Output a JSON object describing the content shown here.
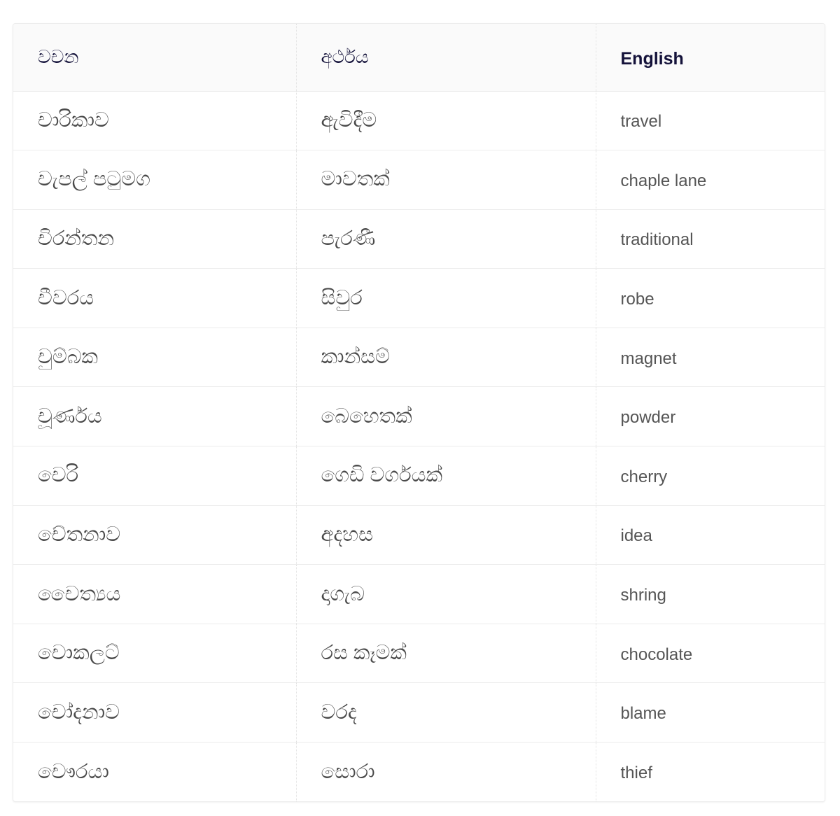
{
  "table": {
    "headers": [
      "වචන",
      "අර්ථය",
      "English"
    ],
    "rows": [
      [
        "චාරිකාව",
        "ඇවිදීම",
        "travel"
      ],
      [
        "චැපල් පටුමග",
        "මාවතක්",
        "chaple lane"
      ],
      [
        "චිරන්තන",
        "පැරණී",
        "traditional"
      ],
      [
        "චීවරය",
        "සිවුර",
        "robe"
      ],
      [
        "චුම්බක",
        "කාන්සම්",
        "magnet"
      ],
      [
        "චූර්ණය",
        "බෙහෙතක්",
        "powder"
      ],
      [
        "චෙරි",
        "ගෙඩි වර්ගයක්",
        "cherry"
      ],
      [
        "චේතනාව",
        "අදහස",
        "idea"
      ],
      [
        "චෛත්‍යය",
        "දාගැබ",
        "shring"
      ],
      [
        "චොකලට්",
        "රස කෑමක්",
        "chocolate"
      ],
      [
        "චෝදනාව",
        "වරද",
        "blame"
      ],
      [
        "චෞරයා",
        "සොරා",
        "thief"
      ]
    ]
  },
  "colors": {
    "header_text": "#14123a",
    "body_text": "#4a4a4a",
    "header_bg": "#fafafa",
    "border": "#ececec"
  }
}
